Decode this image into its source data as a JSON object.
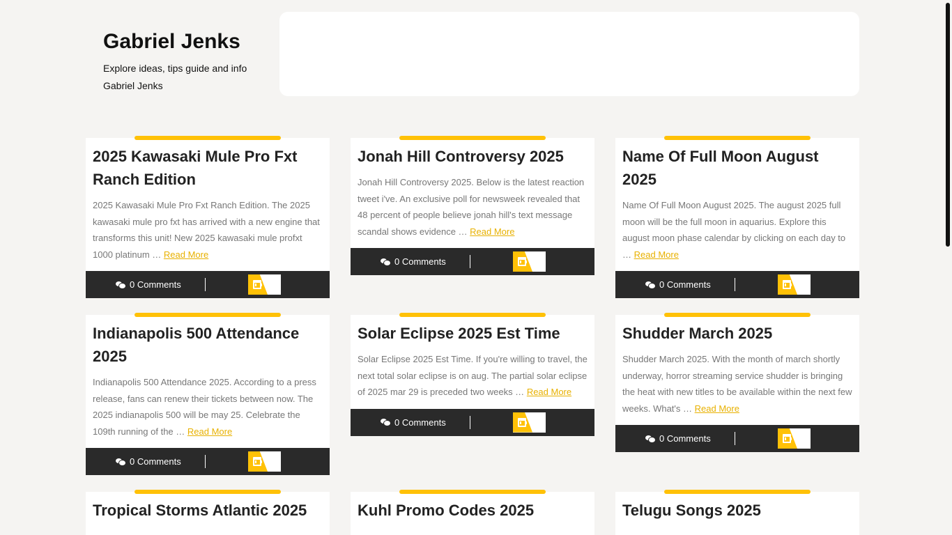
{
  "site": {
    "title": "Gabriel Jenks",
    "description": "Explore ideas, tips guide and info Gabriel Jenks"
  },
  "posts": [
    {
      "title": "2025 Kawasaki Mule Pro Fxt Ranch Edition",
      "excerpt": "2025 Kawasaki Mule Pro Fxt Ranch Edition. The 2025 kawasaki mule pro fxt has arrived with a new engine that transforms this unit! New 2025 kawasaki mule profxt 1000 platinum …",
      "read_more": "Read More",
      "comments": "0 Comments"
    },
    {
      "title": "Jonah Hill Controversy 2025",
      "excerpt": "Jonah Hill Controversy 2025. Below is the latest reaction tweet i've. An exclusive poll for newsweek revealed that 48 percent of people believe jonah hill's text message scandal shows evidence …",
      "read_more": "Read More",
      "comments": "0 Comments"
    },
    {
      "title": "Name Of Full Moon August 2025",
      "excerpt": "Name Of Full Moon August 2025. The august 2025 full moon will be the full moon in aquarius. Explore this august moon phase calendar by clicking on each day to …",
      "read_more": "Read More",
      "comments": "0 Comments"
    },
    {
      "title": "Indianapolis 500 Attendance 2025",
      "excerpt": "Indianapolis 500 Attendance 2025. According to a press release, fans can renew their tickets between now. The 2025 indianapolis 500 will be may 25. Celebrate the 109th running of the …",
      "read_more": "Read More",
      "comments": "0 Comments"
    },
    {
      "title": "Solar Eclipse 2025 Est Time",
      "excerpt": "Solar Eclipse 2025 Est Time. If you're willing to travel, the next total solar eclipse is on aug. The partial solar eclipse of 2025 mar 29 is preceded two weeks …",
      "read_more": "Read More",
      "comments": "0 Comments"
    },
    {
      "title": "Shudder March 2025",
      "excerpt": "Shudder March 2025. With the month of march shortly underway, horror streaming service shudder is bringing the heat with new titles to be available within the next few weeks. What's …",
      "read_more": "Read More",
      "comments": "0 Comments"
    },
    {
      "title": "Tropical Storms Atlantic 2025",
      "excerpt": "",
      "read_more": "",
      "comments": ""
    },
    {
      "title": "Kuhl Promo Codes 2025",
      "excerpt": "",
      "read_more": "",
      "comments": ""
    },
    {
      "title": "Telugu Songs 2025",
      "excerpt": "",
      "read_more": "",
      "comments": ""
    }
  ]
}
